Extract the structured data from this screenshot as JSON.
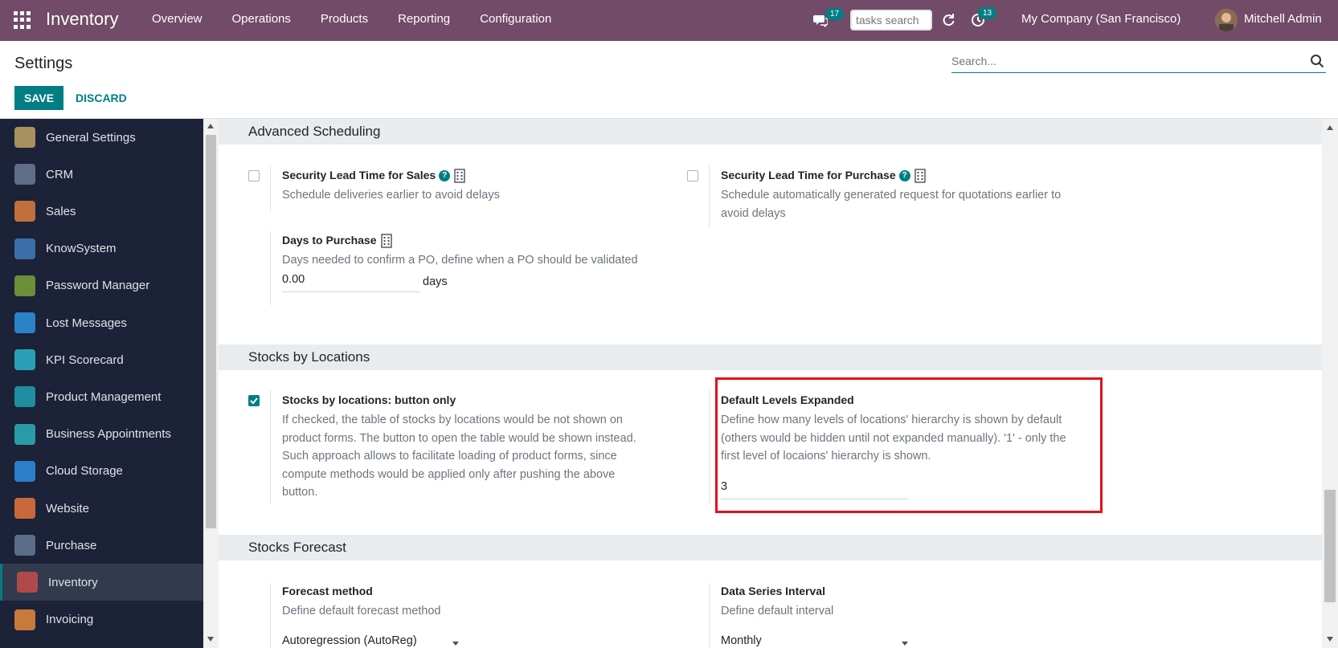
{
  "topbar": {
    "app_name": "Inventory",
    "menu": [
      "Overview",
      "Operations",
      "Products",
      "Reporting",
      "Configuration"
    ],
    "chat_badge": "17",
    "tasks_placeholder": "tasks search",
    "activity_badge": "13",
    "company": "My Company (San Francisco)",
    "user": "Mitchell Admin"
  },
  "control": {
    "title": "Settings",
    "save_label": "SAVE",
    "discard_label": "DISCARD",
    "search_placeholder": "Search..."
  },
  "sidebar": {
    "items": [
      {
        "label": "General Settings",
        "color": "#a89060"
      },
      {
        "label": "CRM",
        "color": "#5f6d87"
      },
      {
        "label": "Sales",
        "color": "#c0703c"
      },
      {
        "label": "KnowSystem",
        "color": "#3a6fa8"
      },
      {
        "label": "Password Manager",
        "color": "#6b8e3a"
      },
      {
        "label": "Lost Messages",
        "color": "#2a82c8"
      },
      {
        "label": "KPI Scorecard",
        "color": "#2aa0b8"
      },
      {
        "label": "Product Management",
        "color": "#1f8ea0"
      },
      {
        "label": "Business Appointments",
        "color": "#2a9aa8"
      },
      {
        "label": "Cloud Storage",
        "color": "#2a7fc8"
      },
      {
        "label": "Website",
        "color": "#c8683c"
      },
      {
        "label": "Purchase",
        "color": "#5a6e8a"
      },
      {
        "label": "Inventory",
        "color": "#b04a4a"
      },
      {
        "label": "Invoicing",
        "color": "#c87a3c"
      }
    ],
    "active_index": 12
  },
  "sections": {
    "advanced_scheduling": "Advanced Scheduling",
    "stocks_by_locations": "Stocks by Locations",
    "stocks_forecast": "Stocks Forecast"
  },
  "settings": {
    "lead_sales": {
      "title": "Security Lead Time for Sales",
      "desc": "Schedule deliveries earlier to avoid delays",
      "checked": false
    },
    "lead_purchase": {
      "title": "Security Lead Time for Purchase",
      "desc_1": "Schedule automatically generated request for quotations earlier to",
      "desc_2": "avoid delays",
      "checked": false
    },
    "days_to_purchase": {
      "title": "Days to Purchase",
      "desc": "Days needed to confirm a PO, define when a PO should be validated",
      "value": "0.00",
      "unit": "days"
    },
    "stocks_button_only": {
      "title": "Stocks by locations: button only",
      "desc_1": "If checked, the table of stocks by locations would be not shown on",
      "desc_2": "product forms. The button to open the table would be shown instead.",
      "desc_3": "Such approach allows to facilitate loading of product forms, since",
      "desc_4": "compute methods would be applied only after pushing the above",
      "desc_5": "button.",
      "checked": true
    },
    "default_levels": {
      "title": "Default Levels Expanded",
      "desc_1": "Define how many levels of locations' hierarchy is shown by default",
      "desc_2": "(others would be hidden until not expanded manually). '1' - only the",
      "desc_3": "first level of locaions' hierarchy is shown.",
      "value": "3"
    },
    "forecast_method": {
      "title": "Forecast method",
      "desc": "Define default forecast method",
      "value": "Autoregression (AutoReg)"
    },
    "data_series_interval": {
      "title": "Data Series Interval",
      "desc": "Define default interval",
      "value": "Monthly"
    }
  },
  "colors": {
    "topbar": "#714b67",
    "primary": "#017e84",
    "sidebar": "#1c2237",
    "highlight": "#e0121c"
  }
}
